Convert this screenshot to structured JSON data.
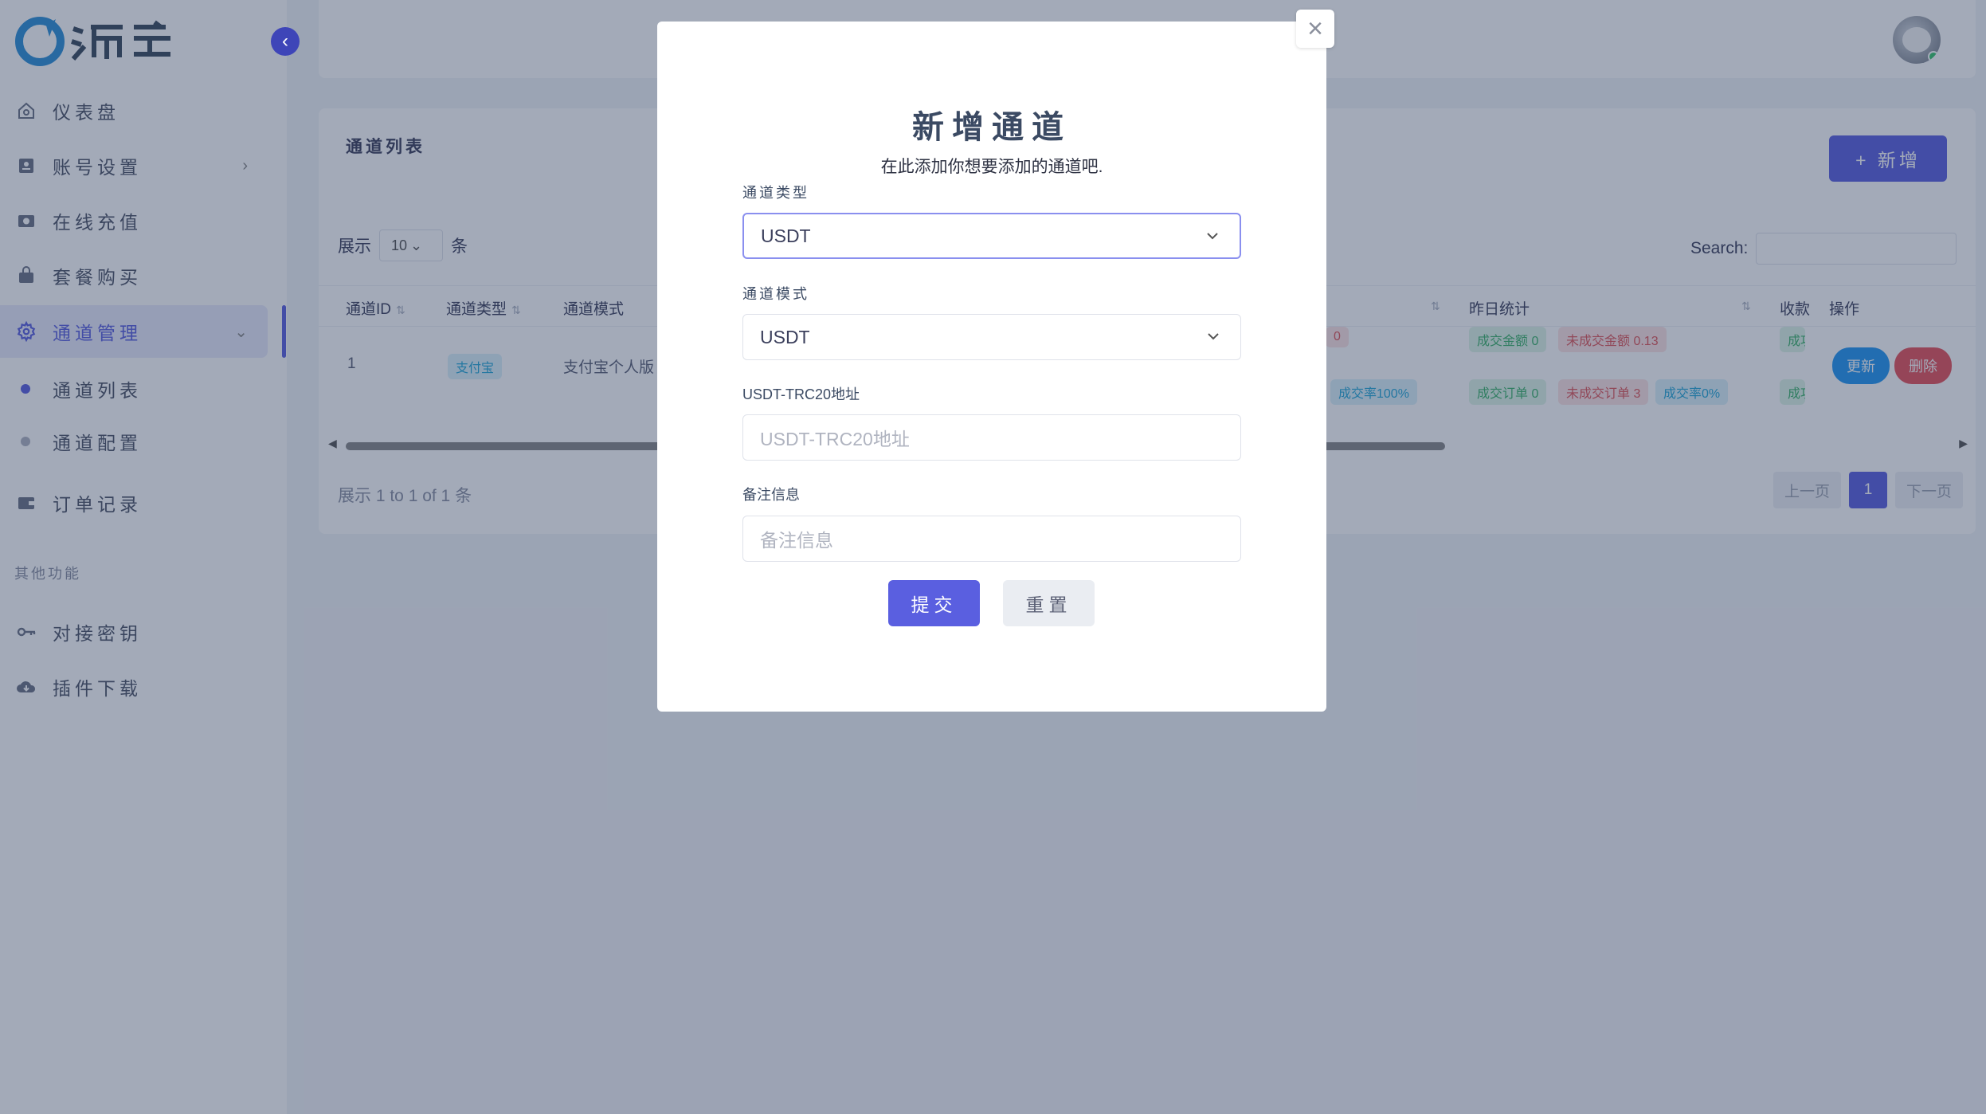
{
  "brand": {
    "logo_text": "源支付",
    "accent": "#5a5fe0"
  },
  "sidebar": {
    "items": [
      {
        "label": "仪表盘",
        "icon": "home-icon"
      },
      {
        "label": "账号设置",
        "icon": "id-card-icon"
      },
      {
        "label": "在线充值",
        "icon": "camera-icon"
      },
      {
        "label": "套餐购买",
        "icon": "shopping-bag-icon"
      },
      {
        "label": "通道管理",
        "icon": "gear-icon"
      },
      {
        "label": "订单记录",
        "icon": "wallet-icon"
      }
    ],
    "sub_items": [
      "通道列表",
      "通道配置"
    ],
    "section_label": "其他功能",
    "other_items": [
      {
        "label": "对接密钥",
        "icon": "key-icon"
      },
      {
        "label": "插件下载",
        "icon": "cloud-download-icon"
      }
    ]
  },
  "main": {
    "card_title": "通道列表",
    "add_button": "+ 新增",
    "length": {
      "prefix": "展示",
      "value": "10",
      "suffix": "条"
    },
    "search_label": "Search:",
    "columns": [
      "通道ID",
      "通道类型",
      "通道模式",
      "昨日统计",
      "收款",
      "操作"
    ],
    "row": {
      "id": "1",
      "type": "支付宝",
      "mode": "支付宝个人版",
      "today_badges": [
        "0",
        "成交率100%"
      ],
      "yesterday_badges": [
        "成交金额 0",
        "未成交金额 0.13",
        "成交订单 0",
        "未成交订单 3",
        "成交率0%"
      ],
      "status_badges": [
        "成功",
        "成功"
      ],
      "update": "更新",
      "delete": "删除"
    },
    "info": "展示 1 to 1 of 1 条",
    "pager": {
      "prev": "上一页",
      "current": "1",
      "next": "下一页"
    }
  },
  "modal": {
    "title": "新增通道",
    "subtitle": "在此添加你想要添加的通道吧.",
    "close": "×",
    "fields": {
      "channel_type": {
        "label": "通道类型",
        "value": "USDT"
      },
      "channel_mode": {
        "label": "通道模式",
        "value": "USDT"
      },
      "address": {
        "label": "USDT-TRC20地址",
        "placeholder": "USDT-TRC20地址"
      },
      "remark": {
        "label": "备注信息",
        "placeholder": "备注信息"
      }
    },
    "submit": "提交",
    "reset": "重置"
  }
}
